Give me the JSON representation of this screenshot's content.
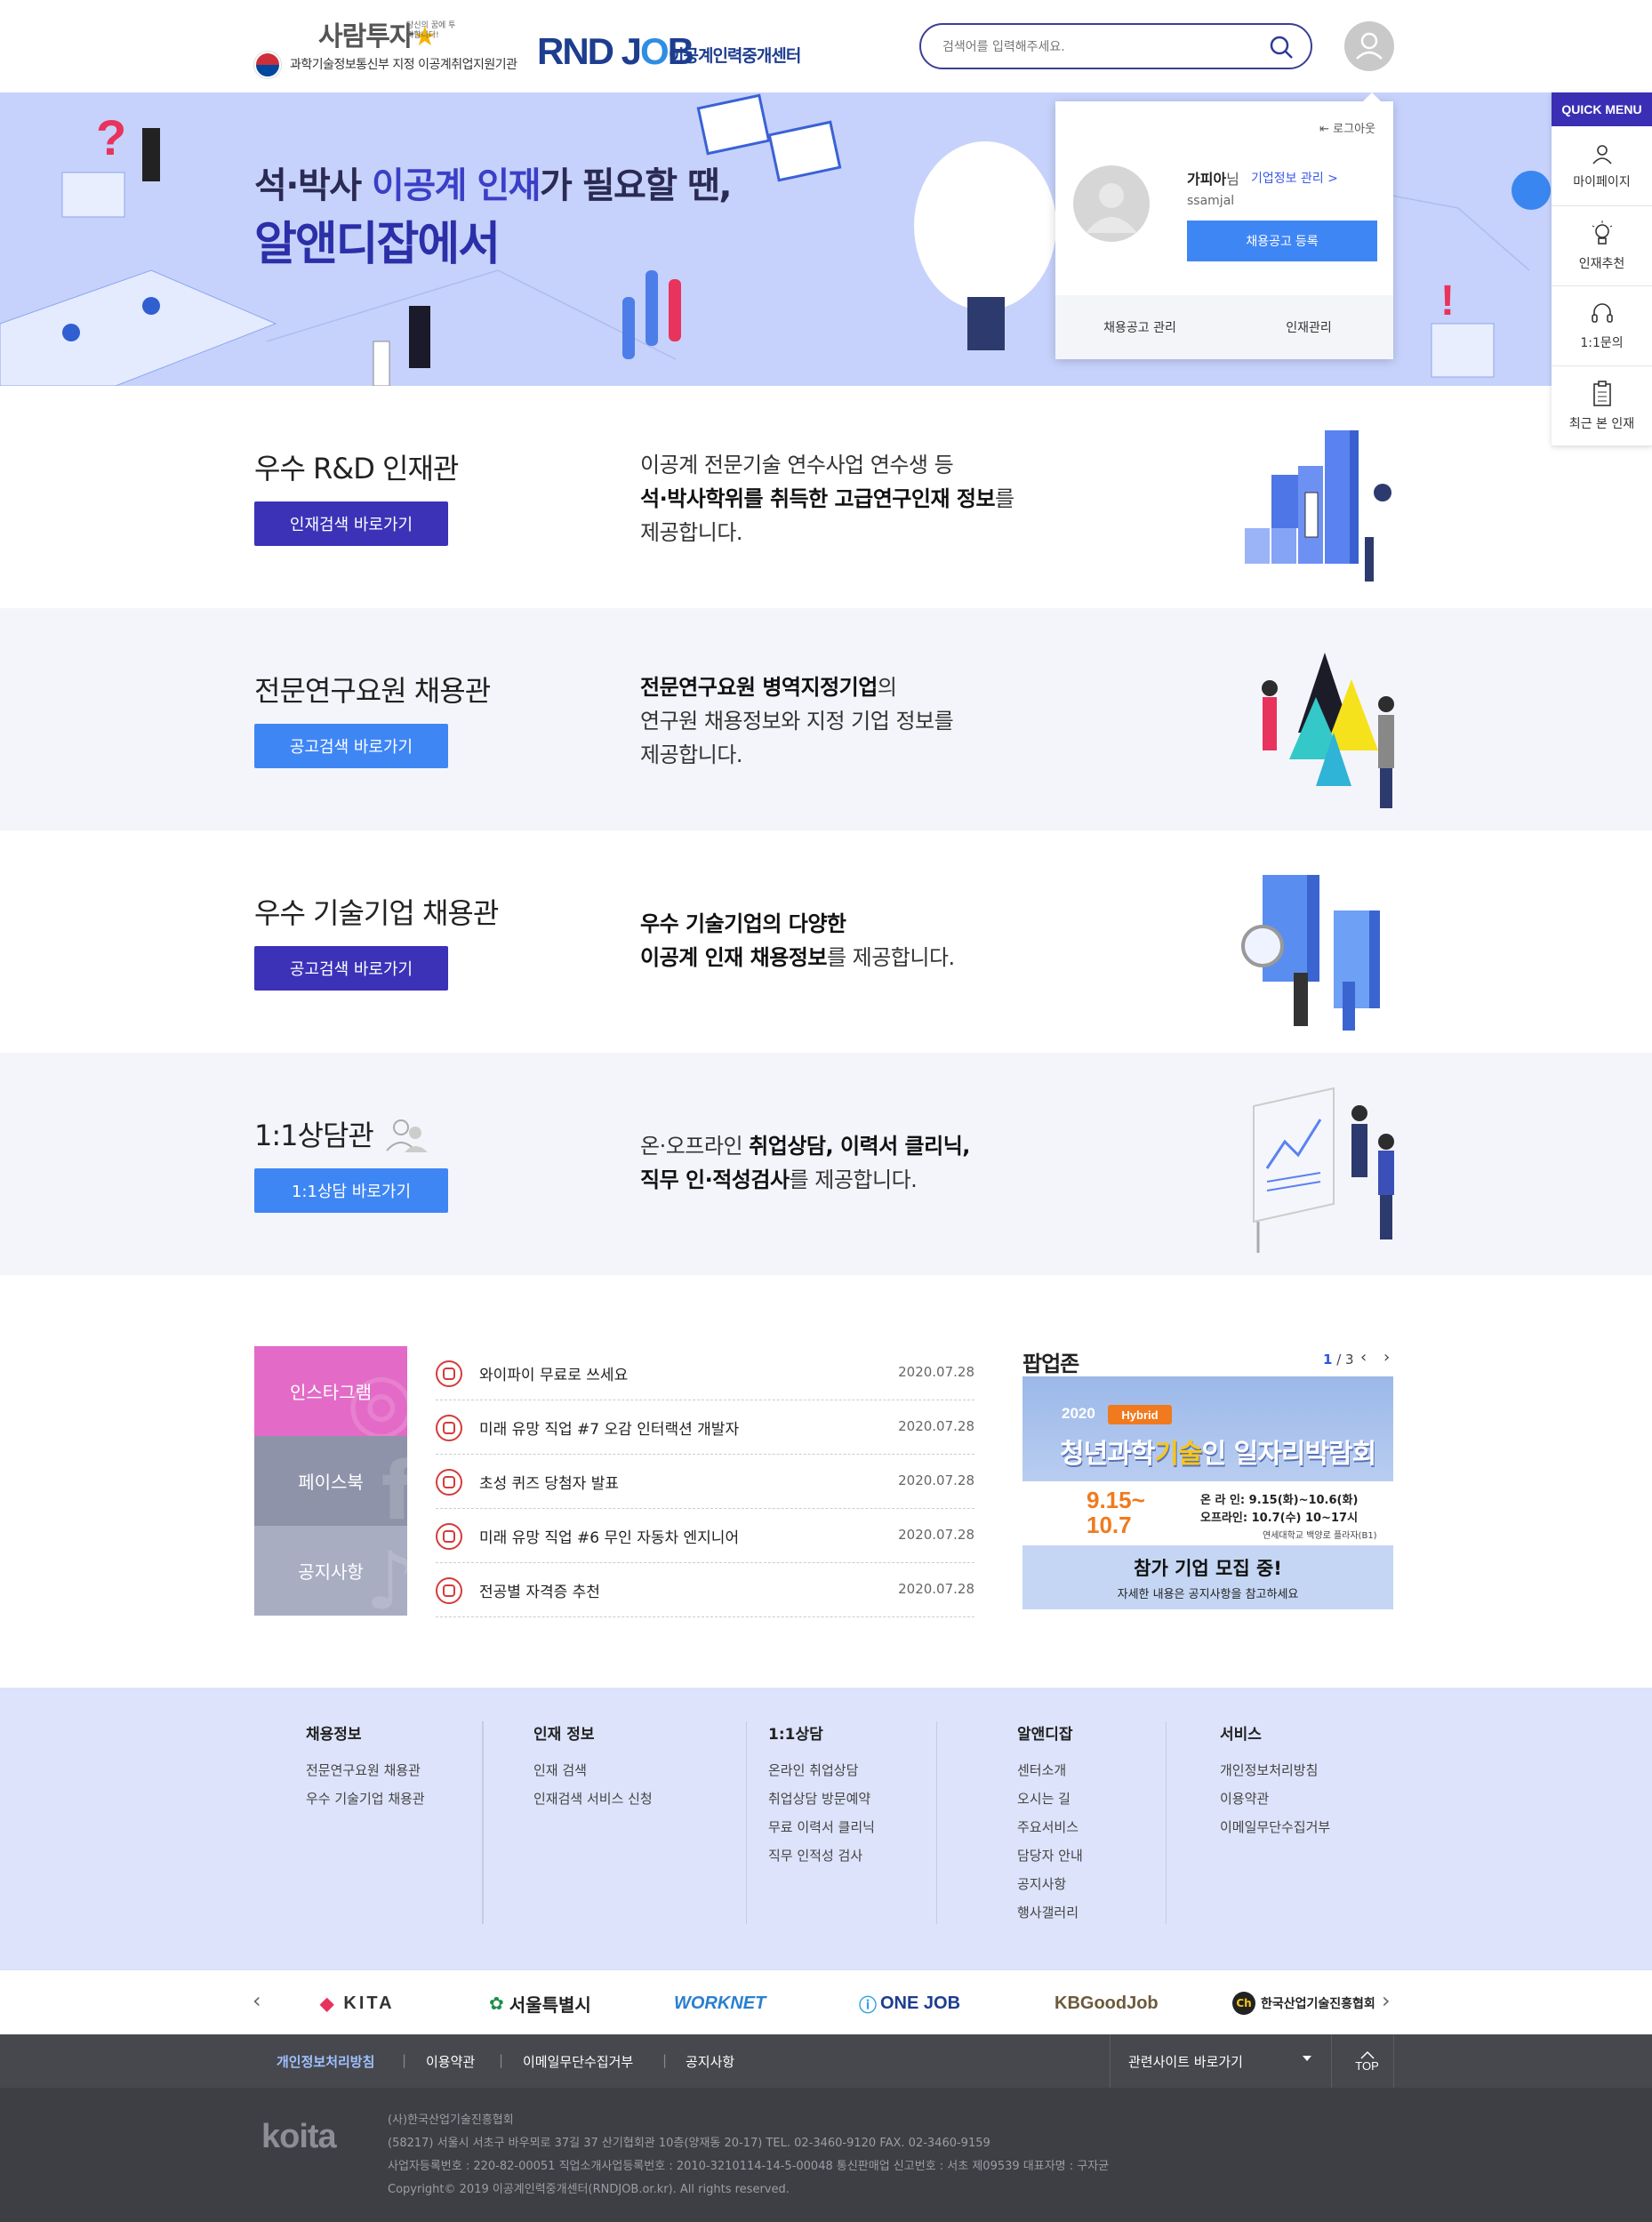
{
  "header": {
    "logo1_title": "사람투자",
    "logo1_slogan": "당신의 꿈에 투자합니다!",
    "logo1_sub": "과학기술정보통신부 지정 이공계취업지원기관",
    "logo2_title_a": "RND J",
    "logo2_title_o": "O",
    "logo2_title_b": "B",
    "logo2_sub": "이공계인력중개센터",
    "search_placeholder": "검색어를 입력해주세요."
  },
  "hero": {
    "line1_a": "석·박사 ",
    "line1_hl": "이공계 인재",
    "line1_b": "가 필요할 땐,",
    "line2": "알앤디잡에서"
  },
  "user_popup": {
    "logout": "로그아웃",
    "name": "가피아",
    "name_suffix": "님",
    "company_link": "기업정보 관리 >",
    "user_id": "ssamjal",
    "register_button": "채용공고 등록",
    "footer_left": "채용공고 관리",
    "footer_right": "인재관리"
  },
  "quick_menu": {
    "title": "QUICK MENU",
    "items": [
      {
        "label": "마이페이지",
        "icon": "person-icon"
      },
      {
        "label": "인재추천",
        "icon": "lightbulb-icon"
      },
      {
        "label": "1:1문의",
        "icon": "headset-icon"
      },
      {
        "label": "최근 본 인재",
        "icon": "clipboard-icon"
      }
    ]
  },
  "sections": [
    {
      "title": "우수 R&D 인재관",
      "button": "인재검색 바로가기",
      "desc1": "이공계 전문기술 연수사업 연수생 등",
      "desc2_bold": "석·박사학위를 취득한 고급연구인재 정보",
      "desc2_rest": "를",
      "desc3": "제공합니다."
    },
    {
      "title": "전문연구요원 채용관",
      "button": "공고검색 바로가기",
      "desc1_bold": "전문연구요원 병역지정기업",
      "desc1_rest": "의",
      "desc2": "연구원 채용정보와 지정 기업 정보를",
      "desc3": "제공합니다."
    },
    {
      "title": "우수 기술기업 채용관",
      "button": "공고검색 바로가기",
      "desc1_bold": "우수 기술기업의 다양한",
      "desc2_bold": "이공계 인재 채용정보",
      "desc2_rest": "를 제공합니다."
    },
    {
      "title": "1:1상담관",
      "button": "1:1상담 바로가기",
      "desc1_a": "온·오프라인 ",
      "desc1_bold": "취업상담, 이력서 클리닉,",
      "desc2_bold": "직무 인·적성검사",
      "desc2_rest": "를 제공합니다."
    }
  ],
  "social_tabs": [
    "인스타그램",
    "페이스북",
    "공지사항"
  ],
  "news": [
    {
      "title": "와이파이 무료로 쓰세요",
      "date": "2020.07.28"
    },
    {
      "title": "미래 유망 직업 #7 오감 인터랙션 개발자",
      "date": "2020.07.28"
    },
    {
      "title": "초성 퀴즈 당첨자 발표",
      "date": "2020.07.28"
    },
    {
      "title": "미래 유망 직업 #6 무인 자동차 엔지니어",
      "date": "2020.07.28"
    },
    {
      "title": "전공별 자격증 추천",
      "date": "2020.07.28"
    }
  ],
  "popzone": {
    "title": "팝업존",
    "page_current": "1",
    "page_total": "/ 3",
    "banner": {
      "year": "2020",
      "tag": "Hybrid",
      "title_a": "청년과학",
      "title_b": "기술",
      "title_c": "인 일자리박람회",
      "date1": "9.15~",
      "date2": "10.7",
      "info1": "온 라 인: 9.15(화)~10.6(화)",
      "info2": "오프라인: 10.7(수) 10~17시",
      "info3": "연세대학교 백양로 플라자(B1)",
      "cta1": "참가 기업 모집 중!",
      "cta2": "자세한 내용은 공지사항을 참고하세요"
    }
  },
  "footer_nav": [
    {
      "title": "채용정보",
      "links": [
        "전문연구요원 채용관",
        "우수 기술기업 채용관"
      ]
    },
    {
      "title": "인재 정보",
      "links": [
        "인재 검색",
        "인재검색 서비스 신청"
      ]
    },
    {
      "title": "1:1상담",
      "links": [
        "온라인 취업상담",
        "취업상담 방문예약",
        "무료 이력서 클리닉",
        "직무 인적성 검사"
      ]
    },
    {
      "title": "알앤디잡",
      "links": [
        "센터소개",
        "오시는 길",
        "주요서비스",
        "담당자 안내",
        "공지사항",
        "행사갤러리"
      ]
    },
    {
      "title": "서비스",
      "links": [
        "개인정보처리방침",
        "이용약관",
        "이메일무단수집거부"
      ]
    }
  ],
  "partners": [
    "KITA",
    "서울특별시",
    "WORKNET",
    "ONE JOB",
    "KBGoodJob",
    "한국산업기술진흥협회"
  ],
  "footer_bar": {
    "links": [
      "개인정보처리방침",
      "이용약관",
      "이메일무단수집거부",
      "공지사항"
    ],
    "related_select": "관련사이트 바로가기",
    "top": "TOP"
  },
  "footer_info": {
    "logo": "koita",
    "lines": [
      "(사)한국산업기술진흥협회",
      "(58217) 서울시 서초구 바우뫼로 37길 37 산기협회관 10층(양재동 20-17)     TEL. 02-3460-9120     FAX. 02-3460-9159",
      "사업자등록번호 : 220-82-00051     직업소개사업등록번호 : 2010-3210114-14-5-00048     통신판매업 신고번호 : 서초 제09539     대표자명 : 구자균",
      "Copyright© 2019 이공계인력중개센터(RNDJOB.or.kr). All rights reserved."
    ]
  },
  "colors": {
    "brand_navy": "#1d3d8f",
    "purple": "#3b32b8",
    "blue": "#3f86f5",
    "hero_bg": "#c6d2fb",
    "insta": "#e36bc7"
  }
}
